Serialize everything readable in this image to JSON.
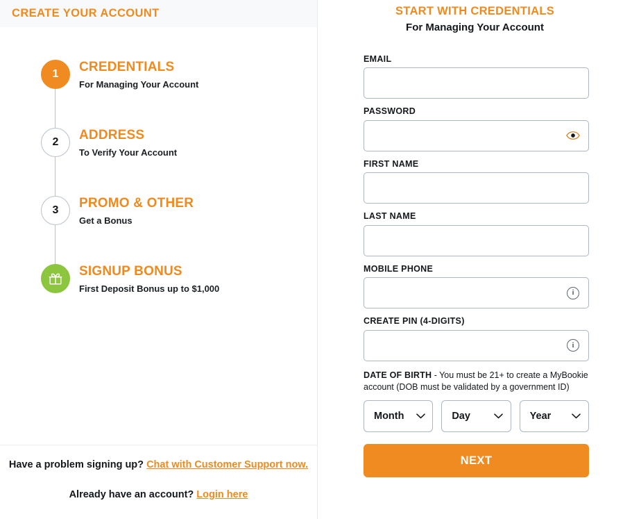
{
  "left": {
    "header_title": "CREATE YOUR ACCOUNT",
    "steps": [
      {
        "marker": "1",
        "marker_kind": "active",
        "title": "CREDENTIALS",
        "subtitle": "For Managing Your Account"
      },
      {
        "marker": "2",
        "marker_kind": "inactive",
        "title": "ADDRESS",
        "subtitle": "To Verify Your Account"
      },
      {
        "marker": "3",
        "marker_kind": "inactive",
        "title": "PROMO & OTHER",
        "subtitle": "Get a Bonus"
      },
      {
        "marker": "gift-icon",
        "marker_kind": "bonus",
        "title": "SIGNUP BONUS",
        "subtitle": "First Deposit Bonus up to $1,000"
      }
    ],
    "footer": {
      "support_question": "Have a problem signing up?",
      "support_link": "Chat with Customer Support now.",
      "login_question": "Already have an account?",
      "login_link": "Login here"
    }
  },
  "right": {
    "title": "START WITH CREDENTIALS",
    "subtitle": "For Managing Your Account",
    "fields": [
      {
        "label": "EMAIL",
        "value": "",
        "placeholder": "",
        "adornment": "none"
      },
      {
        "label": "PASSWORD",
        "value": "",
        "placeholder": "",
        "adornment": "eye-icon"
      },
      {
        "label": "FIRST NAME",
        "value": "",
        "placeholder": "",
        "adornment": "none"
      },
      {
        "label": "LAST NAME",
        "value": "",
        "placeholder": "",
        "adornment": "none"
      },
      {
        "label": "MOBILE PHONE",
        "value": "",
        "placeholder": "",
        "adornment": "info-icon"
      },
      {
        "label": "CREATE PIN (4-DIGITS)",
        "value": "",
        "placeholder": "",
        "adornment": "info-icon"
      }
    ],
    "dob": {
      "label": "DATE OF BIRTH",
      "note": "- You must be 21+ to create a MyBookie account (DOB must be validated by a government ID)",
      "month_value": "Month",
      "day_value": "Day",
      "year_value": "Year"
    },
    "next_label": "NEXT"
  },
  "colors": {
    "accent_orange": "#ef8b21",
    "title_orange": "#f08a1e",
    "bonus_green": "#8cc63e",
    "input_border": "#aab7c4",
    "header_band": "#f8f9fb"
  }
}
